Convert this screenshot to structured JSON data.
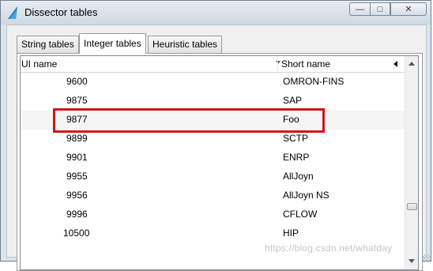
{
  "window": {
    "title": "Dissector tables",
    "minimize_glyph": "—",
    "maximize_glyph": "□",
    "close_glyph": "✕"
  },
  "tabs": [
    {
      "label": "String tables",
      "active": false
    },
    {
      "label": "Integer tables",
      "active": true
    },
    {
      "label": "Heuristic tables",
      "active": false
    }
  ],
  "table": {
    "columns": [
      "UI name",
      "Short name"
    ],
    "rows": [
      {
        "ui_name": "9600",
        "short_name": "OMRON-FINS"
      },
      {
        "ui_name": "9875",
        "short_name": "SAP"
      },
      {
        "ui_name": "9877",
        "short_name": "Foo"
      },
      {
        "ui_name": "9899",
        "short_name": "SCTP"
      },
      {
        "ui_name": "9901",
        "short_name": "ENRP"
      },
      {
        "ui_name": "9955",
        "short_name": "AllJoyn"
      },
      {
        "ui_name": "9956",
        "short_name": "AllJoyn NS"
      },
      {
        "ui_name": "9996",
        "short_name": "CFLOW"
      },
      {
        "ui_name": "10500",
        "short_name": "HIP"
      }
    ],
    "highlighted_row": "9877"
  },
  "watermark": "https://blog.csdn.net/whatday",
  "colors": {
    "highlight_box": "#d0151a",
    "titlebar": "#dde3ea"
  },
  "icons": {
    "app": "wireshark-fin-icon"
  }
}
